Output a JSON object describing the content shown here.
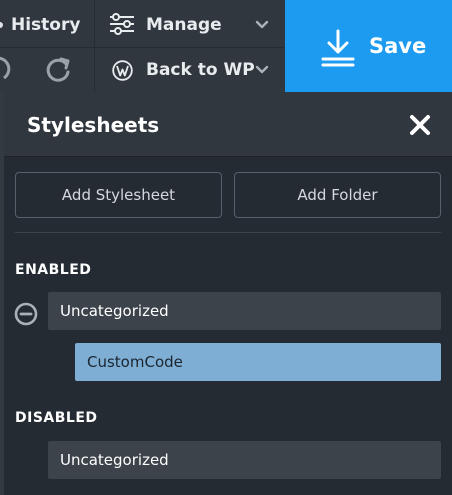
{
  "toolbar": {
    "history_label": "History",
    "manage_label": "Manage",
    "back_to_wp_label": "Back to WP",
    "save_label": "Save",
    "icons": {
      "undo": "undo-icon",
      "redo": "redo-icon",
      "manage": "sliders-icon",
      "back_to_wp": "wordpress-icon",
      "save": "download-icon",
      "dropdown": "chevron-down-icon"
    }
  },
  "panel": {
    "title": "Stylesheets",
    "close_icon": "close-icon",
    "add_stylesheet_label": "Add Stylesheet",
    "add_folder_label": "Add Folder",
    "enabled": {
      "heading": "ENABLED",
      "folder": {
        "label": "Uncategorized",
        "state_icon": "collapse-minus-icon",
        "items": [
          {
            "label": "CustomCode",
            "selected": true
          }
        ]
      }
    },
    "disabled": {
      "heading": "DISABLED",
      "folder": {
        "label": "Uncategorized"
      }
    }
  },
  "colors": {
    "toolbar_bg": "#30373f",
    "panel_bg": "#242b33",
    "save_accent": "#1d9bf0",
    "row_bg": "#3c434b",
    "selected_item_bg": "#7eaed3",
    "button_border": "#58606a"
  }
}
